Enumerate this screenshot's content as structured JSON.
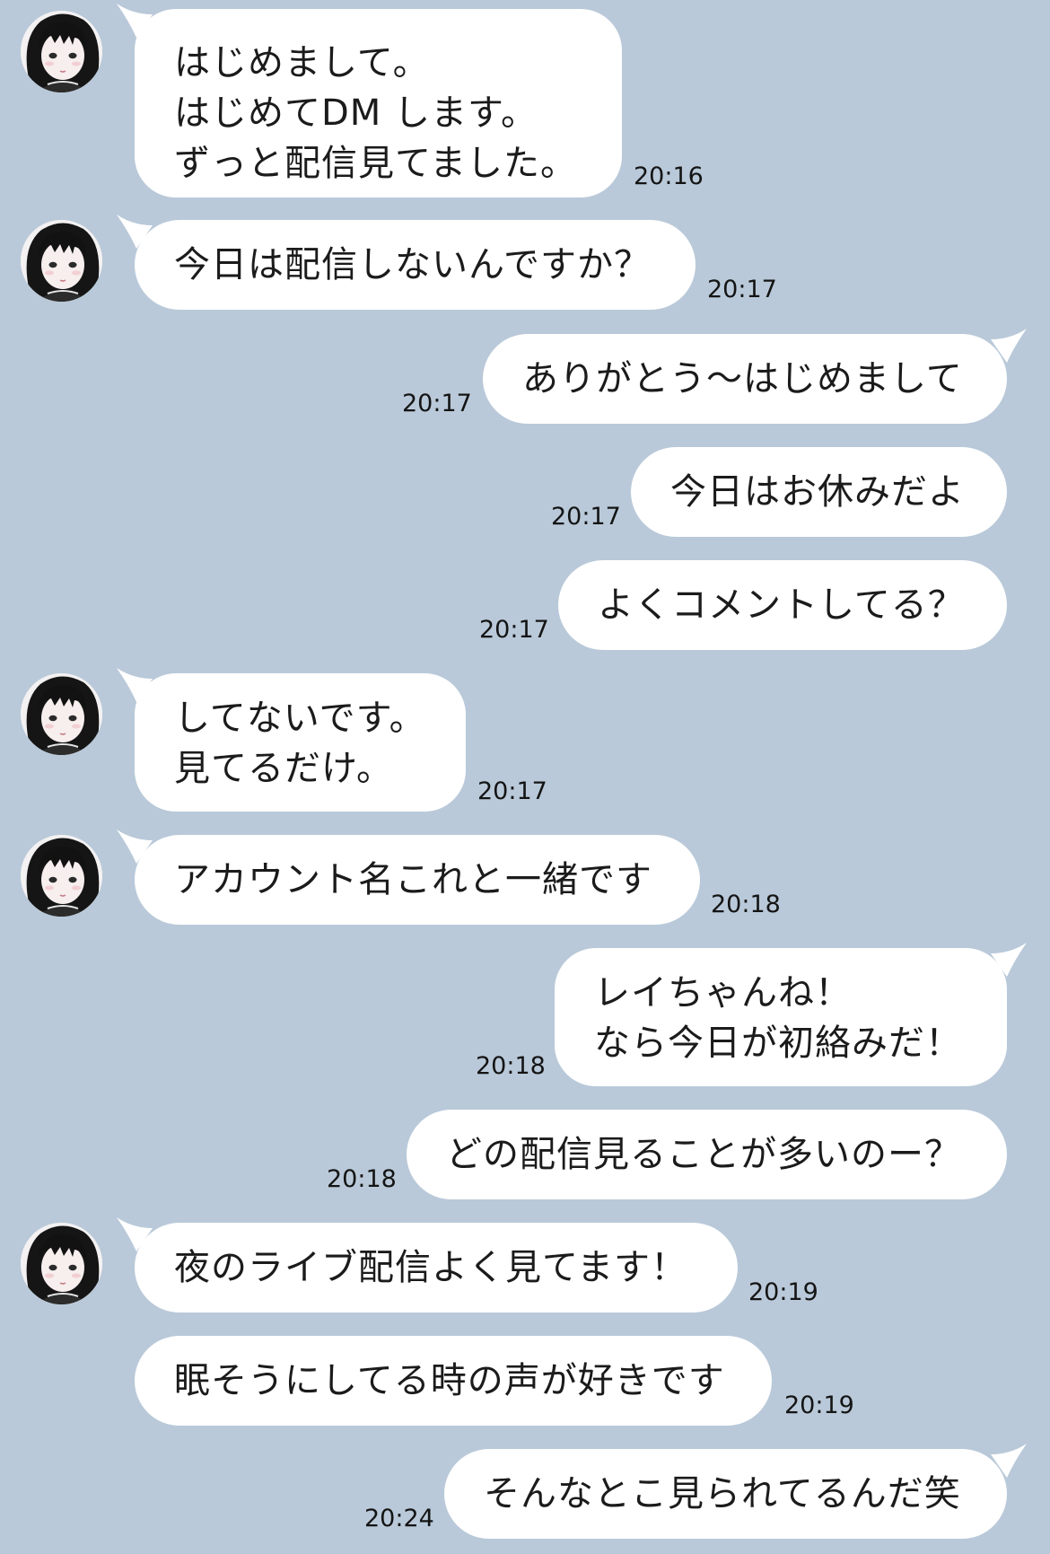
{
  "chat": {
    "messages": [
      {
        "side": "in",
        "text": "はじめまして。\nはじめてDM します。\nずっと配信見てました。",
        "time": "20:16"
      },
      {
        "side": "in",
        "text": "今日は配信しないんですか？",
        "time": "20:17"
      },
      {
        "side": "out",
        "text": "ありがとう〜はじめまして",
        "time": "20:17"
      },
      {
        "side": "out",
        "text": "今日はお休みだよ",
        "time": "20:17"
      },
      {
        "side": "out",
        "text": "よくコメントしてる？",
        "time": "20:17"
      },
      {
        "side": "in",
        "text": "してないです。\n見てるだけ。",
        "time": "20:17"
      },
      {
        "side": "in",
        "text": "アカウント名これと一緒です",
        "time": "20:18"
      },
      {
        "side": "out",
        "text": "レイちゃんね！\nなら今日が初絡みだ！",
        "time": "20:18"
      },
      {
        "side": "out",
        "text": "どの配信見ることが多いのー？",
        "time": "20:18"
      },
      {
        "side": "in",
        "text": "夜のライブ配信よく見てます！",
        "time": "20:19"
      },
      {
        "side": "in",
        "text": "眠そうにしてる時の声が好きです",
        "time": "20:19"
      },
      {
        "side": "out",
        "text": "そんなとこ見られてるんだ笑",
        "time": "20:24"
      }
    ]
  },
  "colors": {
    "background": "#b9c9d9",
    "bubble": "#ffffff",
    "text": "#1b1b1b"
  },
  "icons": {
    "avatar": "user-avatar-icon"
  }
}
